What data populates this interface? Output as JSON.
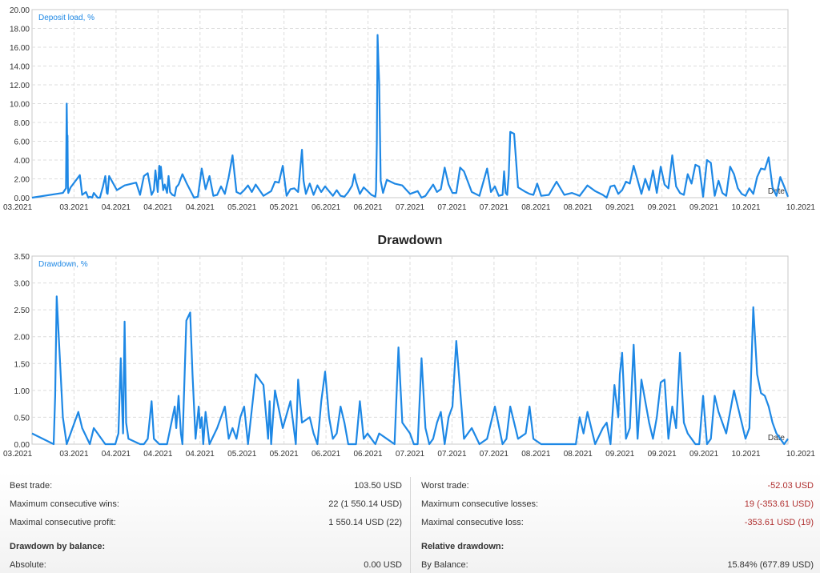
{
  "colors": {
    "line": "#1e88e5",
    "grid": "#dcdcdc",
    "axis_text": "#333333",
    "negative": "#b03030"
  },
  "chart_data": [
    {
      "type": "line",
      "title": "",
      "legend": "Deposit load, %",
      "axis_end_label": "Date",
      "ylim": [
        0,
        20
      ],
      "y_ticks": [
        "0.00",
        "2.00",
        "4.00",
        "6.00",
        "8.00",
        "10.00",
        "12.00",
        "14.00",
        "16.00",
        "18.00",
        "20.00"
      ],
      "x_ticks": [
        "03.2021",
        "03.2021",
        "04.2021",
        "04.2021",
        "04.2021",
        "05.2021",
        "05.2021",
        "06.2021",
        "06.2021",
        "07.2021",
        "07.2021",
        "07.2021",
        "08.2021",
        "08.2021",
        "09.2021",
        "09.2021",
        "09.2021",
        "10.2021",
        "10.2021"
      ],
      "x": [
        0,
        40,
        44,
        45,
        45.5,
        46,
        46.5,
        47,
        50,
        62,
        65,
        70,
        73,
        75,
        78,
        80,
        85,
        88,
        90,
        92,
        95,
        97,
        98,
        100,
        110,
        120,
        135,
        140,
        145,
        150,
        155,
        158,
        160,
        163,
        165,
        166,
        167,
        170,
        172,
        175,
        177,
        179,
        182,
        185,
        187,
        190,
        195,
        200,
        210,
        215,
        220,
        225,
        230,
        235,
        240,
        245,
        250,
        255,
        260,
        265,
        270,
        275,
        280,
        285,
        290,
        300,
        310,
        315,
        320,
        325,
        330,
        335,
        340,
        345,
        350,
        352,
        355,
        360,
        365,
        370,
        375,
        380,
        390,
        395,
        400,
        405,
        410,
        415,
        418,
        420,
        425,
        430,
        440,
        445,
        446,
        447,
        448,
        449,
        450,
        452,
        455,
        460,
        470,
        480,
        490,
        500,
        505,
        510,
        520,
        525,
        530,
        535,
        540,
        545,
        550,
        555,
        560,
        570,
        580,
        590,
        595,
        600,
        605,
        610,
        612,
        614,
        616,
        618,
        620,
        625,
        630,
        640,
        645,
        650,
        655,
        660,
        670,
        680,
        690,
        700,
        710,
        720,
        730,
        740,
        745,
        750,
        755,
        760,
        765,
        770,
        775,
        780,
        790,
        795,
        800,
        805,
        810,
        815,
        820,
        825,
        830,
        835,
        840,
        845,
        850,
        855,
        860,
        865,
        870,
        875,
        880,
        885,
        890,
        895,
        900,
        905,
        910,
        915,
        920,
        925,
        930,
        935,
        940,
        945,
        950,
        955,
        960,
        965,
        970,
        975,
        980
      ],
      "y": [
        0,
        0.5,
        1.0,
        10.0,
        6.5,
        6.6,
        1.2,
        0.5,
        1.1,
        2.4,
        0.3,
        0.6,
        0,
        0.1,
        0,
        0.5,
        0,
        0,
        0.6,
        1.2,
        2.3,
        0.5,
        0.4,
        2.3,
        0.8,
        1.3,
        1.6,
        0.3,
        2.3,
        2.6,
        0.3,
        0.8,
        2.9,
        0.6,
        3.4,
        2.0,
        3.3,
        0.8,
        1.4,
        0.5,
        2.3,
        0.6,
        0.3,
        0.2,
        1.1,
        1.4,
        2.5,
        1.6,
        0,
        0.1,
        3.1,
        0.9,
        2.3,
        0.2,
        0.3,
        1.2,
        0.4,
        2.2,
        4.5,
        0.6,
        0.4,
        0.8,
        1.3,
        0.6,
        1.4,
        0.2,
        0.7,
        1.7,
        1.6,
        3.4,
        0.2,
        0.9,
        1.0,
        0.6,
        5.1,
        1.8,
        0.4,
        1.5,
        0.3,
        1.3,
        0.6,
        1.2,
        0.2,
        0.8,
        0.2,
        0.1,
        0.6,
        1.3,
        2.5,
        1.7,
        0.4,
        1.1,
        0.3,
        0.1,
        0.8,
        6.0,
        17.3,
        14.5,
        12.3,
        1.8,
        0.5,
        1.9,
        1.5,
        1.3,
        0.4,
        0.7,
        0,
        0.2,
        1.4,
        0.6,
        0.9,
        3.2,
        1.4,
        0.5,
        0.5,
        3.2,
        2.8,
        0.6,
        0.2,
        3.1,
        0.6,
        1.2,
        0.2,
        0.3,
        2.8,
        0.5,
        0.3,
        2.4,
        7.0,
        6.8,
        1.1,
        0.6,
        0.4,
        0.3,
        1.5,
        0.2,
        0.3,
        1.7,
        0.3,
        0.5,
        0.2,
        1.3,
        0.7,
        0.3,
        0,
        1.2,
        1.3,
        0.4,
        0.8,
        1.7,
        1.5,
        3.4,
        0.4,
        2.0,
        0.8,
        2.9,
        0.5,
        3.3,
        1.4,
        1.0,
        4.5,
        1.2,
        0.5,
        0.3,
        2.5,
        1.5,
        3.5,
        3.3,
        0.1,
        4.0,
        3.7,
        0.2,
        1.8,
        0.5,
        0.2,
        3.3,
        2.5,
        1.0,
        0.4,
        0.2,
        1.0,
        0.4,
        2.2,
        3.1,
        3.0,
        4.3,
        1.1,
        0.2,
        2.2,
        1.2,
        0.1,
        1.2,
        1.3,
        0.6,
        1.2,
        1.6
      ]
    },
    {
      "type": "line",
      "title": "Drawdown",
      "legend": "Drawdown, %",
      "axis_end_label": "Date",
      "ylim": [
        0,
        3.5
      ],
      "y_ticks": [
        "0.00",
        "0.50",
        "1.00",
        "1.50",
        "2.00",
        "2.50",
        "3.00",
        "3.50"
      ],
      "x_ticks": [
        "03.2021",
        "03.2021",
        "04.2021",
        "04.2021",
        "04.2021",
        "05.2021",
        "05.2021",
        "06.2021",
        "06.2021",
        "07.2021",
        "07.2021",
        "07.2021",
        "08.2021",
        "08.2021",
        "09.2021",
        "09.2021",
        "09.2021",
        "10.2021",
        "10.2021"
      ],
      "x": [
        0,
        28,
        30,
        32,
        40,
        45,
        60,
        65,
        75,
        80,
        95,
        108,
        112,
        115,
        117,
        118,
        120,
        122,
        125,
        140,
        145,
        150,
        155,
        158,
        165,
        175,
        185,
        187,
        190,
        193,
        195,
        200,
        205,
        208,
        212,
        216,
        218,
        220,
        222,
        225,
        230,
        240,
        250,
        255,
        260,
        265,
        270,
        275,
        280,
        290,
        300,
        306,
        308,
        310,
        315,
        325,
        335,
        342,
        345,
        350,
        360,
        365,
        370,
        375,
        380,
        385,
        390,
        395,
        400,
        405,
        410,
        415,
        420,
        425,
        430,
        435,
        440,
        445,
        450,
        460,
        470,
        475,
        480,
        490,
        495,
        500,
        505,
        510,
        515,
        520,
        525,
        530,
        535,
        540,
        545,
        550,
        560,
        570,
        580,
        590,
        600,
        610,
        615,
        620,
        630,
        640,
        645,
        650,
        660,
        670,
        680,
        690,
        700,
        705,
        710,
        715,
        720,
        730,
        740,
        745,
        750,
        755,
        760,
        762,
        765,
        770,
        775,
        780,
        785,
        790,
        795,
        800,
        805,
        810,
        815,
        820,
        825,
        830,
        835,
        840,
        845,
        850,
        855,
        860,
        865,
        870,
        875,
        880,
        885,
        890,
        900,
        910,
        920,
        925,
        930,
        935,
        940,
        945,
        950,
        955,
        960,
        965,
        970,
        975,
        980
      ],
      "y": [
        0.2,
        0.0,
        0.9,
        2.75,
        0.5,
        0.0,
        0.6,
        0.3,
        0.0,
        0.3,
        0.0,
        0.0,
        0.2,
        1.6,
        0.6,
        0.2,
        2.28,
        0.4,
        0.1,
        0.0,
        0.0,
        0.1,
        0.8,
        0.1,
        0.0,
        0.0,
        0.7,
        0.3,
        0.9,
        0.2,
        0.0,
        2.3,
        2.45,
        1.3,
        0.1,
        0.7,
        0.3,
        0.5,
        0.0,
        0.6,
        0.0,
        0.3,
        0.7,
        0.1,
        0.3,
        0.1,
        0.5,
        0.7,
        0.0,
        1.3,
        1.1,
        0.1,
        0.8,
        0.0,
        1.0,
        0.3,
        0.8,
        0.0,
        1.2,
        0.4,
        0.5,
        0.2,
        0.0,
        0.8,
        1.35,
        0.5,
        0.1,
        0.2,
        0.7,
        0.4,
        0.0,
        0.0,
        0.0,
        0.8,
        0.1,
        0.2,
        0.1,
        0.0,
        0.2,
        0.1,
        0.0,
        1.8,
        0.4,
        0.2,
        0.0,
        0.0,
        1.6,
        0.3,
        0.0,
        0.1,
        0.4,
        0.6,
        0.0,
        0.5,
        0.7,
        1.92,
        0.1,
        0.3,
        0.0,
        0.1,
        0.7,
        0.0,
        0.1,
        0.7,
        0.1,
        0.2,
        0.7,
        0.1,
        0.0,
        0.0,
        0.0,
        0.0,
        0.0,
        0.0,
        0.5,
        0.2,
        0.6,
        0.0,
        0.3,
        0.4,
        0.0,
        1.1,
        0.5,
        1.3,
        1.7,
        0.1,
        0.3,
        1.85,
        0.1,
        1.2,
        0.8,
        0.4,
        0.1,
        0.5,
        1.15,
        1.2,
        0.1,
        0.7,
        0.3,
        1.7,
        0.4,
        0.2,
        0.1,
        0.0,
        0.0,
        0.9,
        0.0,
        0.1,
        0.9,
        0.6,
        0.2,
        1.0,
        0.4,
        0.1,
        0.3,
        2.55,
        1.3,
        0.95,
        0.9,
        0.7,
        0.4,
        0.2,
        0.1,
        0.0,
        0.1
      ]
    }
  ],
  "stats": {
    "left": [
      {
        "label": "Best trade:",
        "value": "103.50 USD",
        "type": "row"
      },
      {
        "label": "Maximum consecutive wins:",
        "value": "22 (1 550.14 USD)",
        "type": "row"
      },
      {
        "label": "Maximal consecutive profit:",
        "value": "1 550.14 USD (22)",
        "type": "row"
      },
      {
        "label": "Drawdown by balance:",
        "value": "",
        "type": "head"
      },
      {
        "label": "Absolute:",
        "value": "0.00 USD",
        "type": "row"
      }
    ],
    "right": [
      {
        "label": "Worst trade:",
        "value": "-52.03 USD",
        "type": "row",
        "neg": true
      },
      {
        "label": "Maximum consecutive losses:",
        "value": "19 (-353.61 USD)",
        "type": "row",
        "neg": true
      },
      {
        "label": "Maximal consecutive loss:",
        "value": "-353.61 USD (19)",
        "type": "row",
        "neg": true
      },
      {
        "label": "Relative drawdown:",
        "value": "",
        "type": "head"
      },
      {
        "label": "By Balance:",
        "value": "15.84% (677.89 USD)",
        "type": "row",
        "neg": false
      }
    ]
  }
}
